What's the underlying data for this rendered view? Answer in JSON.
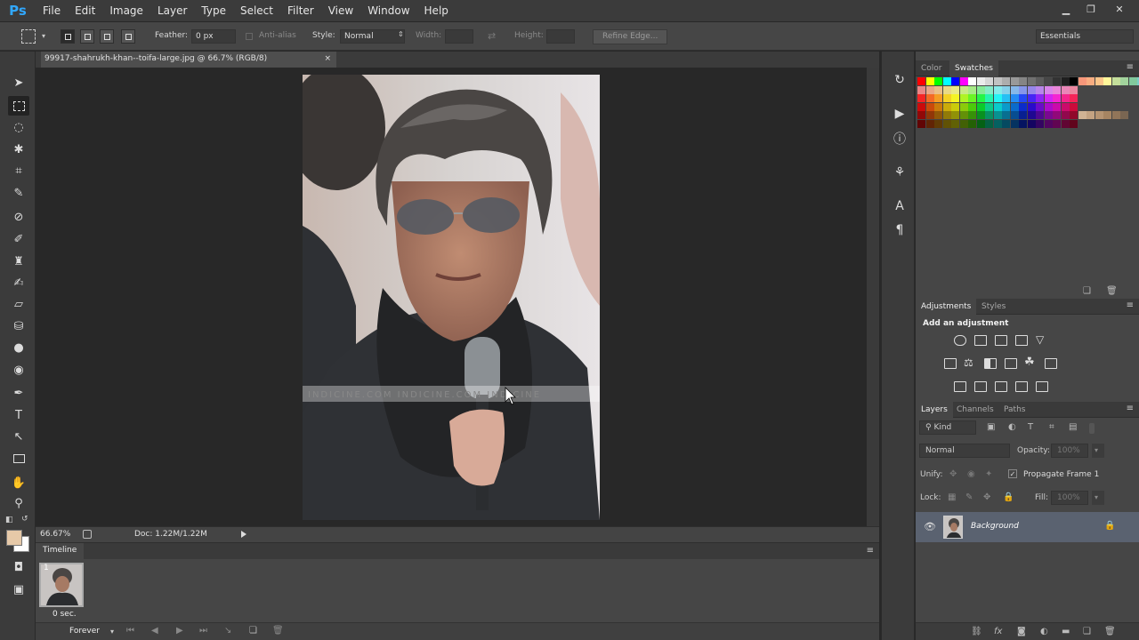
{
  "app": {
    "logo": "Ps"
  },
  "menu": [
    "File",
    "Edit",
    "Image",
    "Layer",
    "Type",
    "Select",
    "Filter",
    "View",
    "Window",
    "Help"
  ],
  "window_controls": {
    "minimize": "▁",
    "restore": "❐",
    "close": "✕"
  },
  "options": {
    "feather_label": "Feather:",
    "feather_value": "0 px",
    "antialias_label": "Anti-alias",
    "style_label": "Style:",
    "style_value": "Normal",
    "width_label": "Width:",
    "height_label": "Height:",
    "refine_label": "Refine Edge...",
    "workspace": "Essentials"
  },
  "document": {
    "tab_title": "99917-shahrukh-khan--toifa-large.jpg @ 66.7% (RGB/8)",
    "close": "×",
    "watermark": "INDICINE.COM    INDICINE.COM    INDICINE"
  },
  "status": {
    "zoom": "66.67%",
    "doc": "Doc: 1.22M/1.22M"
  },
  "timeline": {
    "tab": "Timeline",
    "frame_number": "1",
    "frame_delay": "0 sec.",
    "loop": "Forever"
  },
  "color_panel": {
    "tab_color": "Color",
    "tab_swatches": "Swatches"
  },
  "adjustments": {
    "tab_adjustments": "Adjustments",
    "tab_styles": "Styles",
    "heading": "Add an adjustment"
  },
  "layers": {
    "tab_layers": "Layers",
    "tab_channels": "Channels",
    "tab_paths": "Paths",
    "filter_kind": "Kind",
    "blend_mode": "Normal",
    "opacity_label": "Opacity:",
    "opacity_value": "100%",
    "unify_label": "Unify:",
    "propagate_label": "Propagate Frame 1",
    "lock_label": "Lock:",
    "fill_label": "Fill:",
    "fill_value": "100%",
    "items": [
      {
        "name": "Background",
        "locked": true
      }
    ]
  },
  "colors": {
    "foreground": "#e6c9a8",
    "background": "#ffffff",
    "selected_layer": "#5a6270"
  }
}
